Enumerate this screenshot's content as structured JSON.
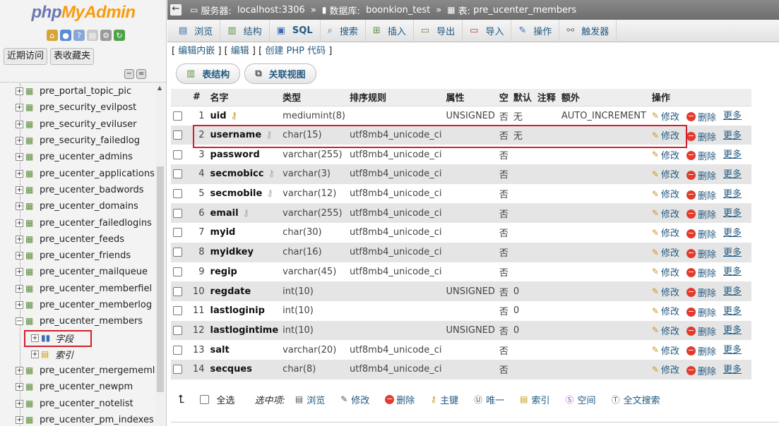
{
  "nav": {
    "logo_a": "php",
    "logo_b": "MyAdmin",
    "tabs": [
      "近期访问",
      "表收藏夹"
    ],
    "tree": [
      {
        "label": "pre_portal_topic_pic"
      },
      {
        "label": "pre_security_evilpost"
      },
      {
        "label": "pre_security_eviluser"
      },
      {
        "label": "pre_security_failedlog"
      },
      {
        "label": "pre_ucenter_admins"
      },
      {
        "label": "pre_ucenter_applications"
      },
      {
        "label": "pre_ucenter_badwords"
      },
      {
        "label": "pre_ucenter_domains"
      },
      {
        "label": "pre_ucenter_failedlogins"
      },
      {
        "label": "pre_ucenter_feeds"
      },
      {
        "label": "pre_ucenter_friends"
      },
      {
        "label": "pre_ucenter_mailqueue"
      },
      {
        "label": "pre_ucenter_memberfiel"
      },
      {
        "label": "pre_ucenter_memberlog"
      },
      {
        "label": "pre_ucenter_members"
      },
      {
        "label": "字段"
      },
      {
        "label": "索引"
      },
      {
        "label": "pre_ucenter_mergememl"
      },
      {
        "label": "pre_ucenter_newpm"
      },
      {
        "label": "pre_ucenter_notelist"
      },
      {
        "label": "pre_ucenter_pm_indexes"
      }
    ]
  },
  "breadcrumb": {
    "server_label": "服务器:",
    "server": "localhost:3306",
    "db_label": "数据库:",
    "db": "boonkion_test",
    "table_label": "表:",
    "table": "pre_ucenter_members",
    "sep": "»"
  },
  "tabs": [
    "浏览",
    "结构",
    "SQL",
    "搜索",
    "插入",
    "导出",
    "导入",
    "操作",
    "触发器"
  ],
  "edit_links": [
    "编辑内嵌",
    "编辑",
    "创建 PHP 代码"
  ],
  "subtabs": [
    "表结构",
    "关联视图"
  ],
  "table": {
    "headers": [
      "#",
      "名字",
      "类型",
      "排序规则",
      "属性",
      "空",
      "默认",
      "注释",
      "额外",
      "操作"
    ],
    "action_edit": "修改",
    "action_delete": "删除",
    "action_more": "更多",
    "rows": [
      {
        "no": "1",
        "name": "uid",
        "key": "primary",
        "type": "mediumint(8)",
        "collation": "",
        "attr": "UNSIGNED",
        "null": "否",
        "default": "无",
        "comment": "",
        "extra": "AUTO_INCREMENT"
      },
      {
        "no": "2",
        "name": "username",
        "key": "index",
        "type": "char(15)",
        "collation": "utf8mb4_unicode_ci",
        "attr": "",
        "null": "否",
        "default": "无",
        "comment": "",
        "extra": ""
      },
      {
        "no": "3",
        "name": "password",
        "key": "",
        "type": "varchar(255)",
        "collation": "utf8mb4_unicode_ci",
        "attr": "",
        "null": "否",
        "default": "",
        "comment": "",
        "extra": ""
      },
      {
        "no": "4",
        "name": "secmobicc",
        "key": "index",
        "type": "varchar(3)",
        "collation": "utf8mb4_unicode_ci",
        "attr": "",
        "null": "否",
        "default": "",
        "comment": "",
        "extra": ""
      },
      {
        "no": "5",
        "name": "secmobile",
        "key": "index",
        "type": "varchar(12)",
        "collation": "utf8mb4_unicode_ci",
        "attr": "",
        "null": "否",
        "default": "",
        "comment": "",
        "extra": ""
      },
      {
        "no": "6",
        "name": "email",
        "key": "index",
        "type": "varchar(255)",
        "collation": "utf8mb4_unicode_ci",
        "attr": "",
        "null": "否",
        "default": "",
        "comment": "",
        "extra": ""
      },
      {
        "no": "7",
        "name": "myid",
        "key": "",
        "type": "char(30)",
        "collation": "utf8mb4_unicode_ci",
        "attr": "",
        "null": "否",
        "default": "",
        "comment": "",
        "extra": ""
      },
      {
        "no": "8",
        "name": "myidkey",
        "key": "",
        "type": "char(16)",
        "collation": "utf8mb4_unicode_ci",
        "attr": "",
        "null": "否",
        "default": "",
        "comment": "",
        "extra": ""
      },
      {
        "no": "9",
        "name": "regip",
        "key": "",
        "type": "varchar(45)",
        "collation": "utf8mb4_unicode_ci",
        "attr": "",
        "null": "否",
        "default": "",
        "comment": "",
        "extra": ""
      },
      {
        "no": "10",
        "name": "regdate",
        "key": "",
        "type": "int(10)",
        "collation": "",
        "attr": "UNSIGNED",
        "null": "否",
        "default": "0",
        "comment": "",
        "extra": ""
      },
      {
        "no": "11",
        "name": "lastloginip",
        "key": "",
        "type": "int(10)",
        "collation": "",
        "attr": "",
        "null": "否",
        "default": "0",
        "comment": "",
        "extra": ""
      },
      {
        "no": "12",
        "name": "lastlogintime",
        "key": "",
        "type": "int(10)",
        "collation": "",
        "attr": "UNSIGNED",
        "null": "否",
        "default": "0",
        "comment": "",
        "extra": ""
      },
      {
        "no": "13",
        "name": "salt",
        "key": "",
        "type": "varchar(20)",
        "collation": "utf8mb4_unicode_ci",
        "attr": "",
        "null": "否",
        "default": "",
        "comment": "",
        "extra": ""
      },
      {
        "no": "14",
        "name": "secques",
        "key": "",
        "type": "char(8)",
        "collation": "utf8mb4_unicode_ci",
        "attr": "",
        "null": "否",
        "default": "",
        "comment": "",
        "extra": ""
      }
    ]
  },
  "footer": {
    "select_all": "全选",
    "with_selected": "选中项:",
    "actions": [
      "浏览",
      "修改",
      "删除",
      "主键",
      "唯一",
      "索引",
      "空间",
      "全文搜索"
    ]
  },
  "colors": {
    "link": "#235a81",
    "highlight": "#d0212b",
    "logo_php": "#6c78af",
    "logo_myadmin": "#f89c0e"
  }
}
